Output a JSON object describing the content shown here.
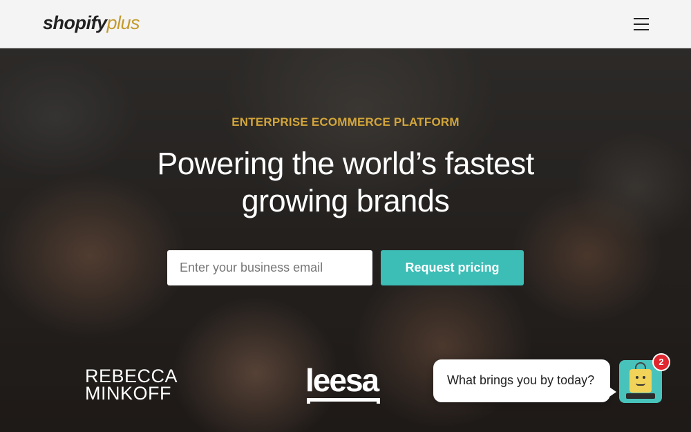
{
  "header": {
    "logo_main": "shopify",
    "logo_plus": "plus",
    "menu_icon": "hamburger-menu-icon"
  },
  "hero": {
    "eyebrow": "ENTERPRISE ECOMMERCE PLATFORM",
    "headline_line1": "Powering the world’s fastest",
    "headline_line2": "growing brands",
    "email_placeholder": "Enter your business email",
    "email_value": "",
    "cta_label": "Request pricing"
  },
  "brands": {
    "rebecca_line1": "REBECCA",
    "rebecca_line2": "MINKOFF",
    "leesa": "leesa"
  },
  "chat": {
    "message": "What brings you by today?",
    "badge_count": "2",
    "launcher_icon": "chatbot-icon"
  },
  "colors": {
    "accent_gold": "#d4a63a",
    "cta_teal": "#3cbdb6",
    "badge_red": "#e0262e"
  }
}
